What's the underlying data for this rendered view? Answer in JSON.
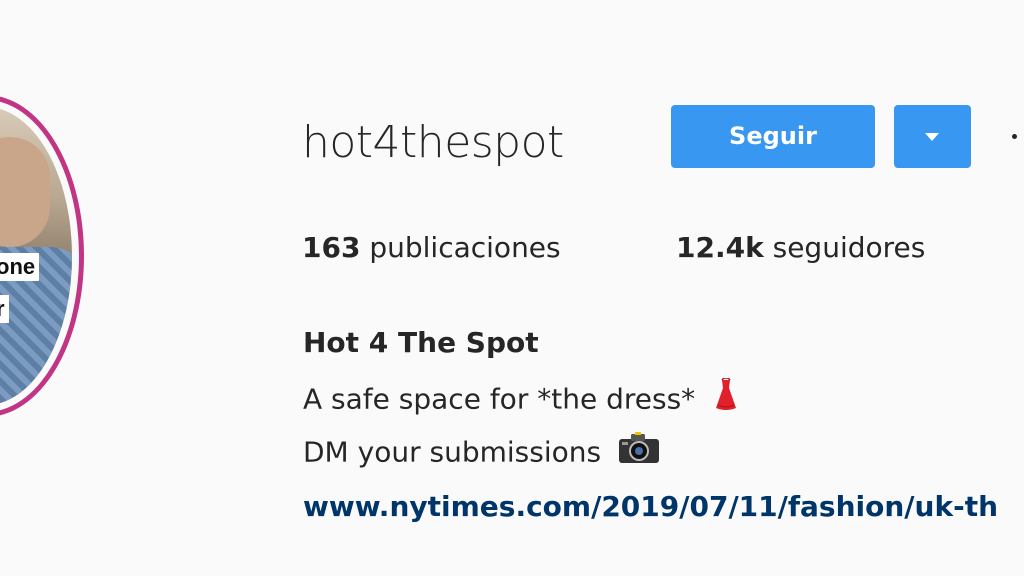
{
  "avatar": {
    "overlay_lines": [
      "one",
      "r"
    ],
    "ring_color": "#c13584"
  },
  "profile": {
    "username": "hot4thespot",
    "follow_label": "Seguir",
    "dropdown_icon": "caret-down-icon",
    "more_icon": "ellipsis-icon",
    "accent_color": "#3897f0"
  },
  "stats": {
    "posts_count": "163",
    "posts_label": " publicaciones",
    "followers_count": "12.4k",
    "followers_label": " seguidores"
  },
  "bio": {
    "full_name": "Hot 4 The Spot",
    "line1": "A safe space for *the dress*",
    "line1_icon": "dress-emoji-icon",
    "line2": "DM your submissions",
    "line2_icon": "camera-emoji-icon",
    "link": "www.nytimes.com/2019/07/11/fashion/uk-th",
    "link_color": "#003569"
  }
}
